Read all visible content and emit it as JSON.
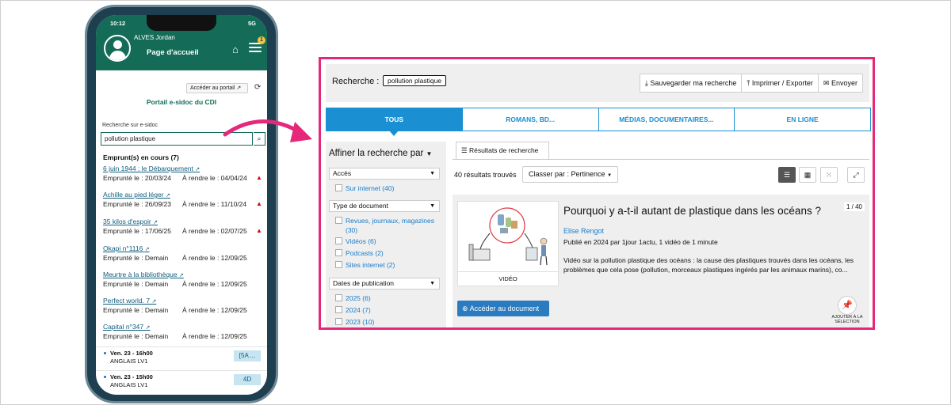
{
  "phone": {
    "status_time": "10:12",
    "status_signal": "5G",
    "user_name": "ALVES Jordan",
    "page_title": "Page d'accueil",
    "notif_count": "1",
    "portal_button": "Accéder au portail",
    "portal_title": "Portail e-sidoc du CDI",
    "search_label": "Recherche sur e-sidoc",
    "search_value": "pollution plastique",
    "loans_title": "Emprunt(s) en cours (7)",
    "loans": [
      {
        "title": "6 juin 1944 : le Débarquement",
        "borrowed": "Emprunté le : 20/03/24",
        "due": "À rendre le : 04/04/24",
        "late": true
      },
      {
        "title": "Achille au pied léger",
        "borrowed": "Emprunté le : 26/09/23",
        "due": "À rendre le : 11/10/24",
        "late": true
      },
      {
        "title": "35 kilos d'espoir",
        "borrowed": "Emprunté le : 17/06/25",
        "due": "À rendre le : 02/07/25",
        "late": true
      },
      {
        "title": "Okapi n°1116",
        "borrowed": "Emprunté le : Demain",
        "due": "À rendre le : 12/09/25",
        "late": false
      },
      {
        "title": "Meurtre à la bibliothèque",
        "borrowed": "Emprunté le : Demain",
        "due": "À rendre le : 12/09/25",
        "late": false
      },
      {
        "title": "Perfect world. 7",
        "borrowed": "Emprunté le : Demain",
        "due": "À rendre le : 12/09/25",
        "late": false
      },
      {
        "title": "Capital n°347",
        "borrowed": "Emprunté le : Demain",
        "due": "À rendre le : 12/09/25",
        "late": false
      }
    ],
    "courses": [
      {
        "time": "Ven. 23 - 16h00",
        "subject": "ANGLAIS LV1",
        "room": "[5A ..."
      },
      {
        "time": "Ven. 23 - 15h00",
        "subject": "ANGLAIS LV1",
        "room": "4D"
      }
    ]
  },
  "desktop": {
    "search_label": "Recherche :",
    "search_term": "pollution plastique",
    "actions": [
      {
        "label": "Sauvegarder ma recherche",
        "icon": "download-icon"
      },
      {
        "label": "Imprimer / Exporter",
        "icon": "upload-icon"
      },
      {
        "label": "Envoyer",
        "icon": "envelope-icon"
      }
    ],
    "tabs": [
      {
        "label": "TOUS",
        "active": true
      },
      {
        "label": "ROMANS, BD...",
        "active": false
      },
      {
        "label": "MÉDIAS, DOCUMENTAIRES...",
        "active": false
      },
      {
        "label": "EN LIGNE",
        "active": false
      }
    ],
    "facets_title": "Affiner la recherche par",
    "facets": {
      "acces": {
        "label": "Accès",
        "items": [
          "Sur internet (40)"
        ]
      },
      "type": {
        "label": "Type de document",
        "items": [
          "Revues, journaux, magazines",
          "(30)",
          "Vidéos (6)",
          "Podcasts (2)",
          "Sites internet (2)"
        ]
      },
      "dates": {
        "label": "Dates de publication",
        "items": [
          "2025 (6)",
          "2024 (7)",
          "2023 (10)"
        ]
      }
    },
    "results_tab": "Résultats de recherche",
    "results_count": "40 résultats trouvés",
    "sort_label": "Classer par : Pertinence",
    "result": {
      "title": "Pourquoi y a-t-il autant de plastique dans les océans ?",
      "page": "1 / 40",
      "author": "Elise Rengot",
      "published": "Publié en 2024 par 1jour 1actu, 1 vidéo de 1 minute",
      "description": "Vidéo sur la pollution plastique des océans : la cause des plastiques trouvés dans les océans, les problèmes que cela pose (pollution, morceaux plastiques ingérés par les animaux marins), co...",
      "media_type": "VIDÉO",
      "access_button": "Accéder au document",
      "add_selection": "AJOUTER À LA SÉLECTION"
    }
  },
  "colors": {
    "brand_green": "#146c58",
    "accent_blue": "#1a8fd1",
    "highlight_pink": "#e6287a",
    "warning_red": "#d0021b"
  }
}
